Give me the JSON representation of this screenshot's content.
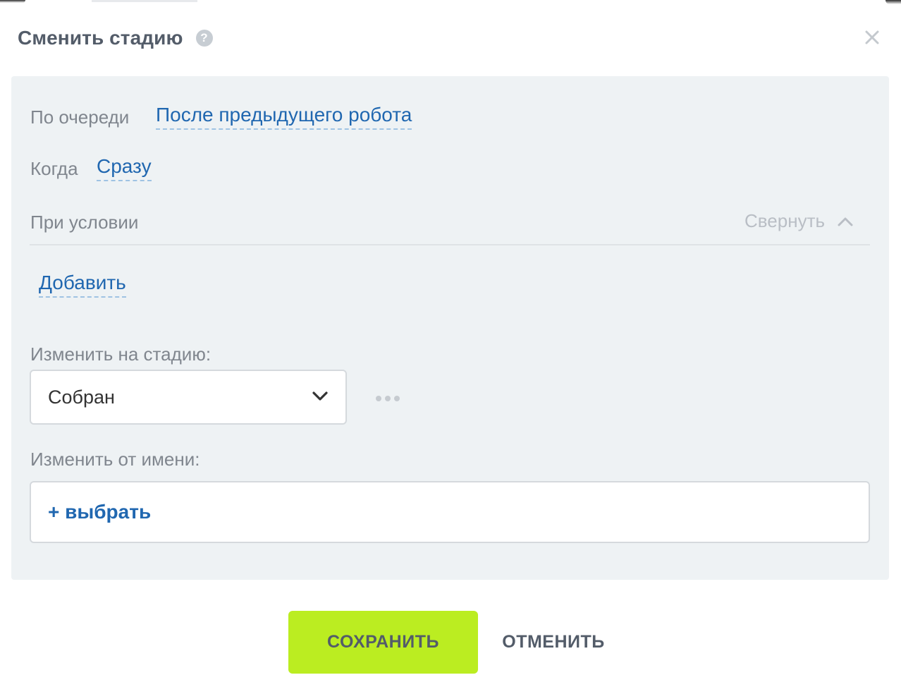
{
  "dialog": {
    "title": "Сменить стадию",
    "help_icon": "?",
    "close_icon": "close-icon"
  },
  "settings": {
    "order_label": "По очереди",
    "order_value": "После предыдущего робота",
    "when_label": "Когда",
    "when_value": "Сразу",
    "condition_label": "При условии",
    "collapse_label": "Свернуть",
    "add_condition": "Добавить"
  },
  "stage": {
    "label": "Изменить на стадию:",
    "selected": "Собран"
  },
  "author": {
    "label": "Изменить от имени:",
    "add_label": "+ выбрать"
  },
  "buttons": {
    "save": "СОХРАНИТЬ",
    "cancel": "ОТМЕНИТЬ"
  },
  "colors": {
    "accent_link": "#2067b0",
    "save_button": "#bbed21",
    "panel_bg": "#eef2f4",
    "title_text": "#535c69"
  }
}
